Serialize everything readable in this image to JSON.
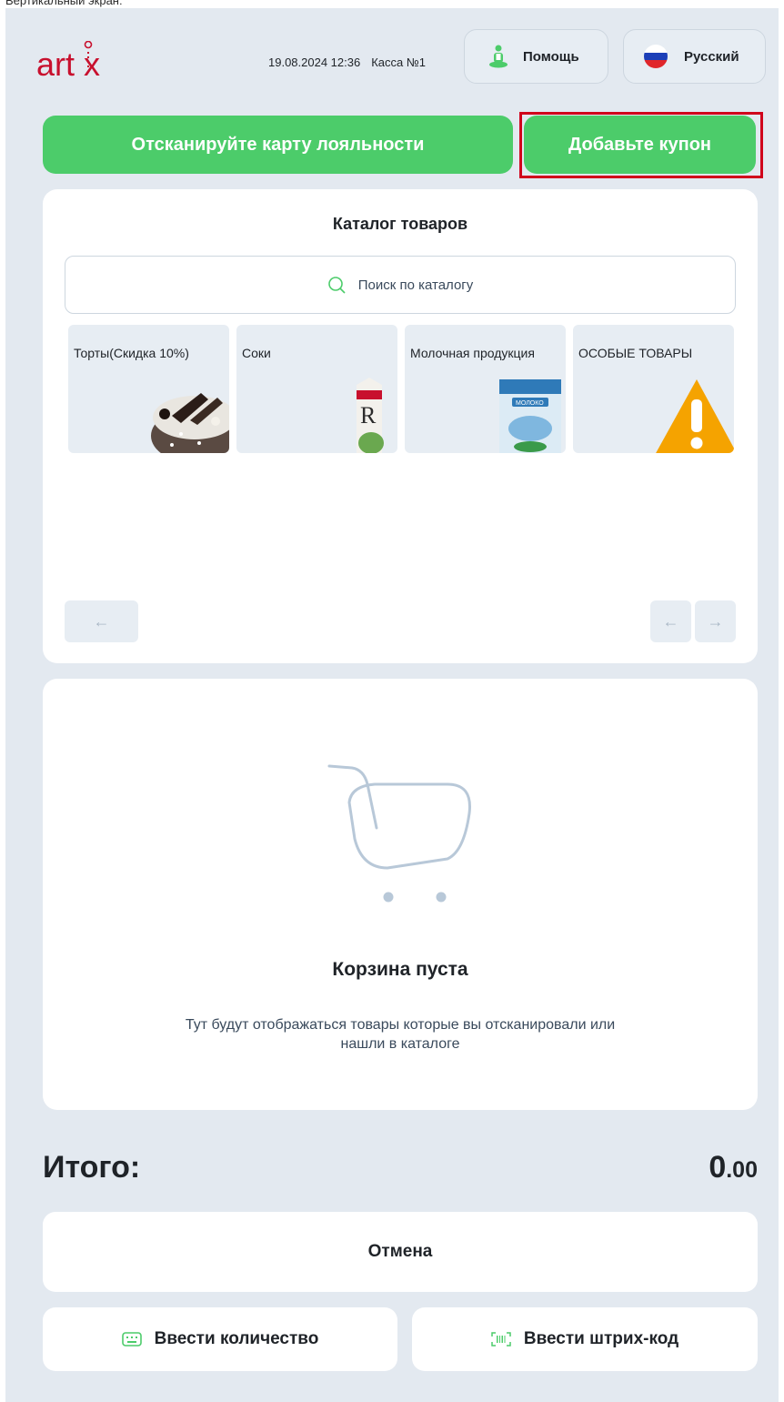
{
  "caption": "Вертикальный экран:",
  "header": {
    "datetime": "19.08.2024 12:36",
    "register": "Касса №1",
    "help_label": "Помощь",
    "language_label": "Русский"
  },
  "actions": {
    "loyalty_label": "Отсканируйте карту лояльности",
    "coupon_label": "Добавьте купон"
  },
  "catalog": {
    "title": "Каталог товаров",
    "search_placeholder": "Поиск по каталогу",
    "categories": [
      {
        "label": "Торты(Скидка 10%)",
        "icon": "cake-image"
      },
      {
        "label": "Соки",
        "icon": "juice-carton-image"
      },
      {
        "label": "Молочная продукция",
        "icon": "milk-pack-image"
      },
      {
        "label": "ОСОБЫЕ ТОВАРЫ",
        "icon": "warning-triangle-icon"
      }
    ],
    "pager": {
      "prev": "←",
      "prev2": "←",
      "next": "→"
    }
  },
  "cart": {
    "empty_title": "Корзина пуста",
    "empty_description": "Тут будут отображаться товары которые вы отсканировали или нашли в каталоге"
  },
  "total": {
    "label": "Итого:",
    "integer": "0",
    "decimal": ".00"
  },
  "bottom": {
    "cancel_label": "Отмена",
    "quantity_label": "Ввести количество",
    "barcode_label": "Ввести штрих-код"
  },
  "colors": {
    "accent_green": "#4ccc6a",
    "brand_red": "#c8102e",
    "highlight_red": "#d0021b",
    "background": "#e3e9f0"
  }
}
